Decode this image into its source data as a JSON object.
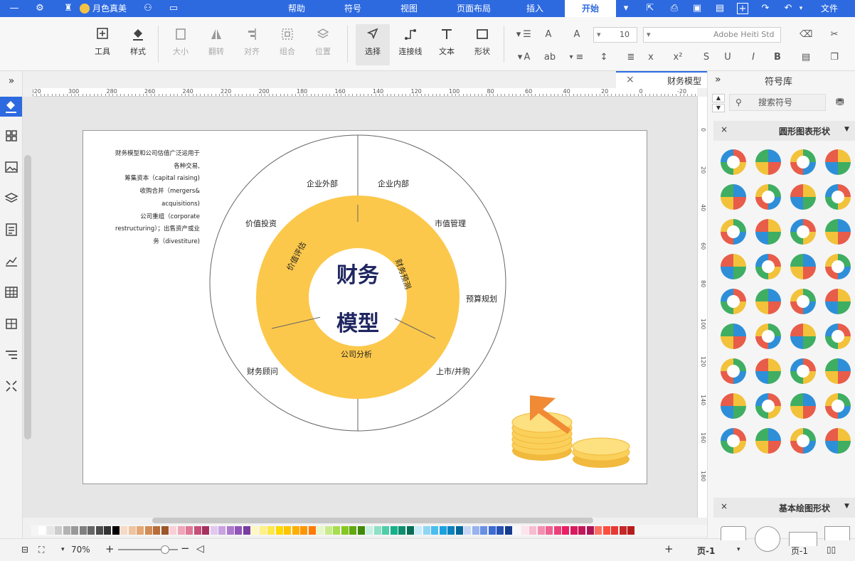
{
  "titlebar": {
    "brand": "月色真美",
    "menus": [
      "文件",
      "开始",
      "插入",
      "页面布局",
      "视图",
      "符号",
      "帮助"
    ]
  },
  "ribbon": {
    "tools": [
      {
        "label": "工具",
        "enabled": true
      },
      {
        "label": "样式",
        "enabled": true
      },
      {
        "label": "大小",
        "enabled": false
      },
      {
        "label": "翻转",
        "enabled": false
      },
      {
        "label": "对齐",
        "enabled": false
      },
      {
        "label": "组合",
        "enabled": false
      },
      {
        "label": "位置",
        "enabled": false
      },
      {
        "label": "选择",
        "enabled": true
      },
      {
        "label": "连接线",
        "enabled": true
      },
      {
        "label": "文本",
        "enabled": true
      },
      {
        "label": "形状",
        "enabled": true
      }
    ],
    "font_size": "10",
    "font_name": "Adobe Heiti Std"
  },
  "document": {
    "tab_title": "财务模型",
    "zoom": "70%",
    "page_label": "页-1",
    "page_tab": "页-1"
  },
  "rulers": {
    "h_ticks": [
      "-20",
      "0",
      "20",
      "40",
      "60",
      "80",
      "100",
      "120",
      "140",
      "160",
      "180",
      "200",
      "220",
      "240",
      "260",
      "280",
      "300",
      "320"
    ],
    "v_ticks": [
      "0",
      "20",
      "40",
      "60",
      "80",
      "100",
      "120",
      "140",
      "160",
      "180"
    ]
  },
  "diagram": {
    "center_title_1": "财务",
    "center_title_2": "模型",
    "inner_ring": [
      "财务预测",
      "价值评估",
      "公司分析"
    ],
    "outer_ring": [
      "企业内部",
      "企业外部",
      "市值管理",
      "价值投资",
      "预算规划",
      "上市/并购",
      "财务顾问"
    ],
    "note_lines": [
      "财务模型和公司估值广泛运用于",
      "各种交易,",
      "筹集资本（capital raising)",
      "收购合并（mergers&",
      "acquisitions)",
      "公司重组（corporate",
      "restructuring）；出售资产或业",
      "务（divestiture)"
    ],
    "colors": {
      "inner_ring": "#fcc84b",
      "title": "#1f2660",
      "coins": "#fbd05a",
      "arrow": "#f08a34"
    }
  },
  "right_panel": {
    "title": "符号库",
    "search_placeholder": "搜索符号",
    "section_1": "圆形图表形状",
    "section_2": "基本绘图形状"
  },
  "colors": {
    "accent": "#2d6ae0"
  }
}
